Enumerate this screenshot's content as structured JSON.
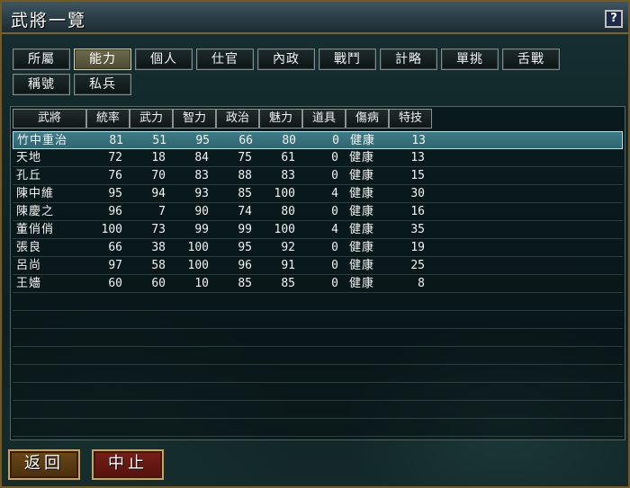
{
  "window": {
    "title": "武將一覽",
    "help_label": "?"
  },
  "tabs": [
    {
      "label": "所屬",
      "active": false
    },
    {
      "label": "能力",
      "active": true
    },
    {
      "label": "個人",
      "active": false
    },
    {
      "label": "仕官",
      "active": false
    },
    {
      "label": "內政",
      "active": false
    },
    {
      "label": "戰鬥",
      "active": false
    },
    {
      "label": "計略",
      "active": false
    },
    {
      "label": "單挑",
      "active": false
    },
    {
      "label": "舌戰",
      "active": false
    },
    {
      "label": "稱號",
      "active": false
    },
    {
      "label": "私兵",
      "active": false
    }
  ],
  "table": {
    "columns": [
      "武將",
      "統率",
      "武力",
      "智力",
      "政治",
      "魅力",
      "道具",
      "傷病",
      "特技"
    ],
    "rows": [
      {
        "name": "竹中重治",
        "lead": "81",
        "war": "51",
        "int": "95",
        "pol": "66",
        "chr": "80",
        "item": "0",
        "cond": "健康",
        "skill": "13",
        "selected": true
      },
      {
        "name": "天地",
        "lead": "72",
        "war": "18",
        "int": "84",
        "pol": "75",
        "chr": "61",
        "item": "0",
        "cond": "健康",
        "skill": "13",
        "selected": false
      },
      {
        "name": "孔丘",
        "lead": "76",
        "war": "70",
        "int": "83",
        "pol": "88",
        "chr": "83",
        "item": "0",
        "cond": "健康",
        "skill": "15",
        "selected": false
      },
      {
        "name": "陳中維",
        "lead": "95",
        "war": "94",
        "int": "93",
        "pol": "85",
        "chr": "100",
        "item": "4",
        "cond": "健康",
        "skill": "30",
        "selected": false
      },
      {
        "name": "陳慶之",
        "lead": "96",
        "war": "7",
        "int": "90",
        "pol": "74",
        "chr": "80",
        "item": "0",
        "cond": "健康",
        "skill": "16",
        "selected": false
      },
      {
        "name": "董俏俏",
        "lead": "100",
        "war": "73",
        "int": "99",
        "pol": "99",
        "chr": "100",
        "item": "4",
        "cond": "健康",
        "skill": "35",
        "selected": false
      },
      {
        "name": "張良",
        "lead": "66",
        "war": "38",
        "int": "100",
        "pol": "95",
        "chr": "92",
        "item": "0",
        "cond": "健康",
        "skill": "19",
        "selected": false
      },
      {
        "name": "呂尚",
        "lead": "97",
        "war": "58",
        "int": "100",
        "pol": "96",
        "chr": "91",
        "item": "0",
        "cond": "健康",
        "skill": "25",
        "selected": false
      },
      {
        "name": "王嬙",
        "lead": "60",
        "war": "60",
        "int": "10",
        "pol": "85",
        "chr": "85",
        "item": "0",
        "cond": "健康",
        "skill": "8",
        "selected": false
      }
    ],
    "total_visible_rows": 17
  },
  "buttons": {
    "back_label": "返回",
    "stop_label": "中止"
  }
}
